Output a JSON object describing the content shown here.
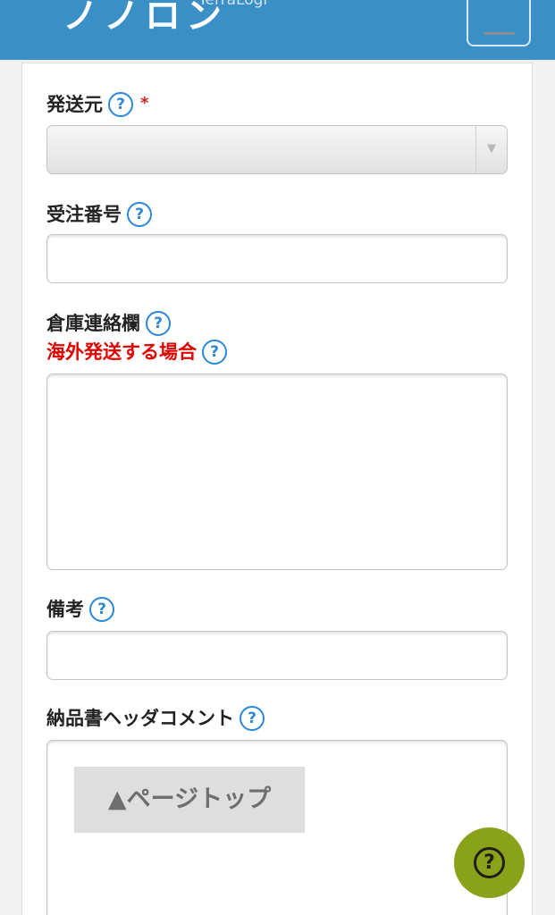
{
  "header": {
    "title": "ノノロン",
    "subtitle": "TerraLogi"
  },
  "icons": {
    "help": "question-circle-icon",
    "menu": "hamburger-menu-icon",
    "select_arrow": "triangle-down-icon"
  },
  "glyphs": {
    "help": "?",
    "required": "*",
    "dropdown": "▼"
  },
  "form": {
    "origin": {
      "label": "発送元",
      "value": ""
    },
    "order_number": {
      "label": "受注番号",
      "value": ""
    },
    "warehouse_note": {
      "label": "倉庫連絡欄",
      "overseas_label": "海外発送する場合",
      "value": ""
    },
    "remarks": {
      "label": "備考",
      "value": ""
    },
    "delivery_header_comment": {
      "label": "納品書ヘッダコメント",
      "value": ""
    }
  },
  "page_top_button": {
    "label": "▲ページトップ"
  },
  "colors": {
    "header_bg": "#3b8fc7",
    "help_icon": "#2b88d8",
    "warning_text": "#e00000",
    "fab_bg": "#8aa219"
  }
}
